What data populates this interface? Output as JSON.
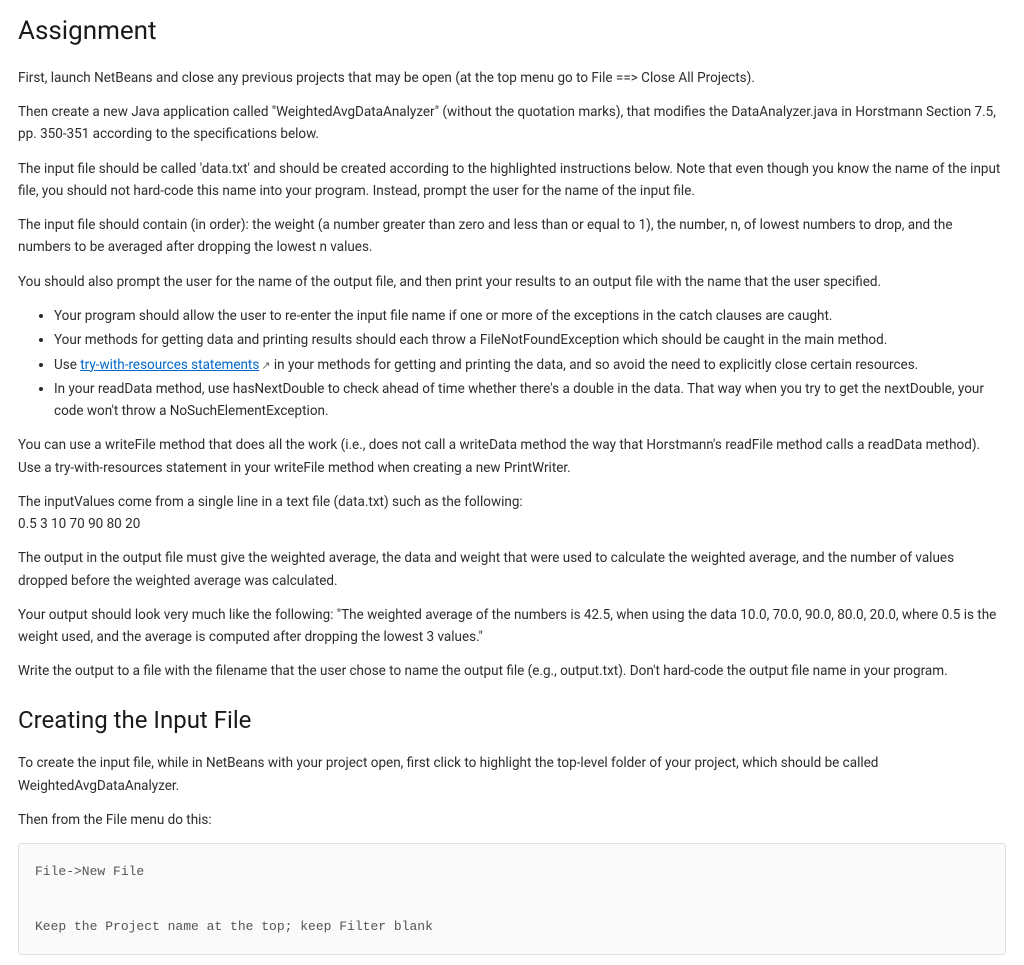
{
  "heading1": "Assignment",
  "p1": "First, launch NetBeans and close any previous projects that may be open (at the top menu go to File ==> Close All Projects).",
  "p2": "Then create a new Java application called \"WeightedAvgDataAnalyzer\" (without the quotation marks), that modifies the DataAnalyzer.java in Horstmann Section 7.5, pp. 350-351 according to the specifications below.",
  "p3": "The input file should be called 'data.txt' and should be created according to the highlighted instructions below. Note that even though you know the name of the input file, you should not hard-code this name into your program. Instead, prompt the user for the name of the input file.",
  "p4": "The input file should contain (in order): the weight (a number greater than zero and less than or equal to 1), the number, n, of lowest numbers to drop, and the numbers to be averaged after dropping the lowest n values.",
  "p5": "You should also prompt the user for the name of the output file, and then print your results to an output file with the name that the user specified.",
  "bullets": [
    "Your program should allow the user to re-enter the input file name if one or more of the exceptions in the catch clauses are caught.",
    "Your methods for getting data and printing results should each throw a FileNotFoundException which should be caught in the main method."
  ],
  "bullet3_prefix": "Use ",
  "bullet3_link": "try-with-resources statements",
  "bullet3_suffix": " in your methods for getting and printing the data, and so avoid the need to explicitly close certain resources.",
  "bullet4": "In your readData method, use hasNextDouble to check ahead of time whether there's a double in the data. That way when you try to get the nextDouble,  your code won't throw a NoSuchElementException.",
  "p6": "You can use a writeFile method that does all the work  (i.e., does not call a writeData method the way that Horstmann's readFile method calls a readData method). Use a try-with-resources statement in your writeFile method when creating a new PrintWriter.",
  "p7": "The inputValues come from a single line in a text file (data.txt) such as the following:",
  "p7b": "0.5 3 10 70 90 80 20",
  "p8": "The output in the output file must give the weighted average, the data and weight that were used to calculate the weighted average, and the number of values dropped before the weighted average was calculated.",
  "p9": "Your output should look very much like the following: \"The weighted average of the numbers is 42.5, when using the data 10.0, 70.0, 90.0, 80.0, 20.0, where 0.5 is the weight used, and the average is computed after dropping the lowest 3 values.\"",
  "p10": "Write the output to a file with the filename that the user chose to name the output file (e.g., output.txt). Don't hard-code the output file name in your program.",
  "heading2": "Creating the Input File",
  "p11": "To create the input file, while in NetBeans with your project open, first click to highlight the top-level folder of your project, which should be called WeightedAvgDataAnalyzer.",
  "p12": "Then from the File menu do this:",
  "codeblock": "File->New File\n\nKeep the Project name at the top; keep Filter blank"
}
